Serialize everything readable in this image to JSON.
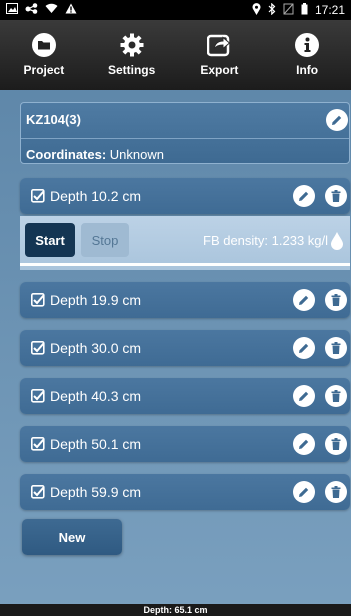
{
  "status_bar": {
    "time": "17:21",
    "left_icons": [
      "gallery-icon",
      "share-icon",
      "wifi-icon",
      "warning-icon"
    ],
    "right_icons": [
      "location-icon",
      "bluetooth-icon",
      "no-sim-icon",
      "battery-icon"
    ]
  },
  "toolbar": {
    "items": [
      {
        "label": "Project",
        "icon": "folder-icon"
      },
      {
        "label": "Settings",
        "icon": "gear-icon"
      },
      {
        "label": "Export",
        "icon": "export-icon"
      },
      {
        "label": "Info",
        "icon": "info-icon"
      }
    ]
  },
  "site": {
    "name": "KZ104(3)",
    "coords_label": "Coordinates:",
    "coords_value": "Unknown"
  },
  "depths": [
    {
      "label": "Depth 10.2 cm",
      "checked": true
    },
    {
      "label": "Depth 19.9 cm",
      "checked": true
    },
    {
      "label": "Depth 30.0 cm",
      "checked": true
    },
    {
      "label": "Depth 40.3 cm",
      "checked": true
    },
    {
      "label": "Depth 50.1 cm",
      "checked": true
    },
    {
      "label": "Depth 59.9 cm",
      "checked": true
    }
  ],
  "measurement": {
    "start_label": "Start",
    "stop_label": "Stop",
    "density_text": "FB density: 1.233 kg/l"
  },
  "new_label": "New",
  "footer": {
    "text": "Depth: 65.1 cm"
  },
  "colors": {
    "background": "#6e95b5",
    "row": "#4577a0",
    "start_button": "#143553",
    "toolbar": "#2a2a2a"
  }
}
